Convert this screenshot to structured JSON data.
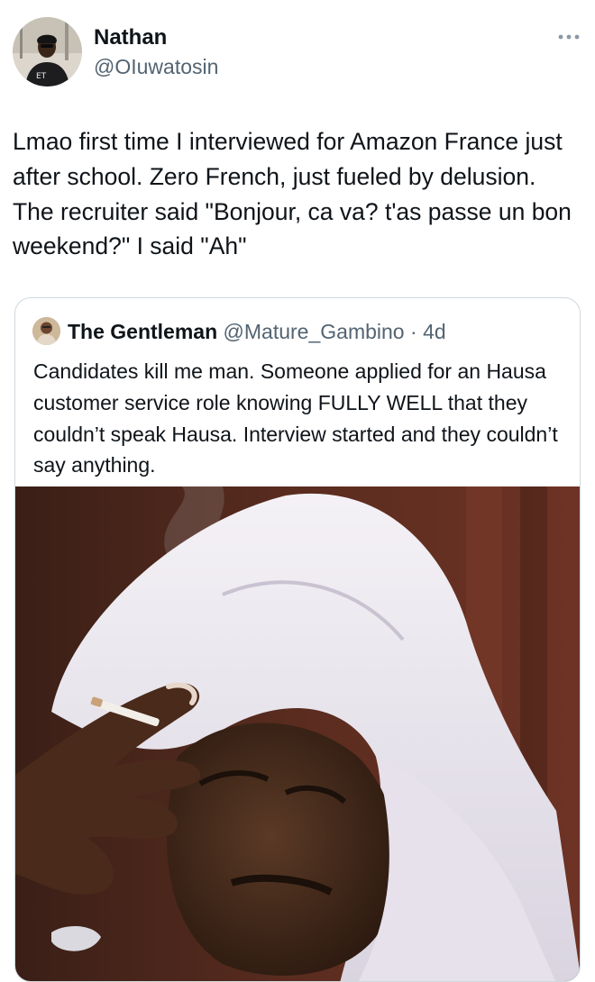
{
  "tweet": {
    "author": {
      "name": "Nathan",
      "handle": "@OIuwatosin",
      "avatar_icon": "profile-photo-avatar"
    },
    "more_icon": "more-options-icon",
    "text": "Lmao first time I interviewed for Amazon France just after school. Zero French, just fueled by delusion. The recruiter said \"Bonjour, ca va? t'as passe un bon weekend?\" I said \"Ah\""
  },
  "quoted_tweet": {
    "author": {
      "name": "The Gentleman",
      "handle": "@Mature_Gambino",
      "separator": "·",
      "time": "4d",
      "avatar_icon": "profile-photo-avatar"
    },
    "text": "Candidates kill me man. Someone applied for an Hausa customer service role knowing FULLY WELL that they couldn’t speak Hausa. Interview started and they couldn’t say anything.",
    "media": {
      "kind": "photo",
      "description_icon": "meme-photo"
    }
  },
  "colors": {
    "text_primary": "#0f1419",
    "text_secondary": "#536471",
    "border": "#cfd9de",
    "background": "#ffffff"
  }
}
